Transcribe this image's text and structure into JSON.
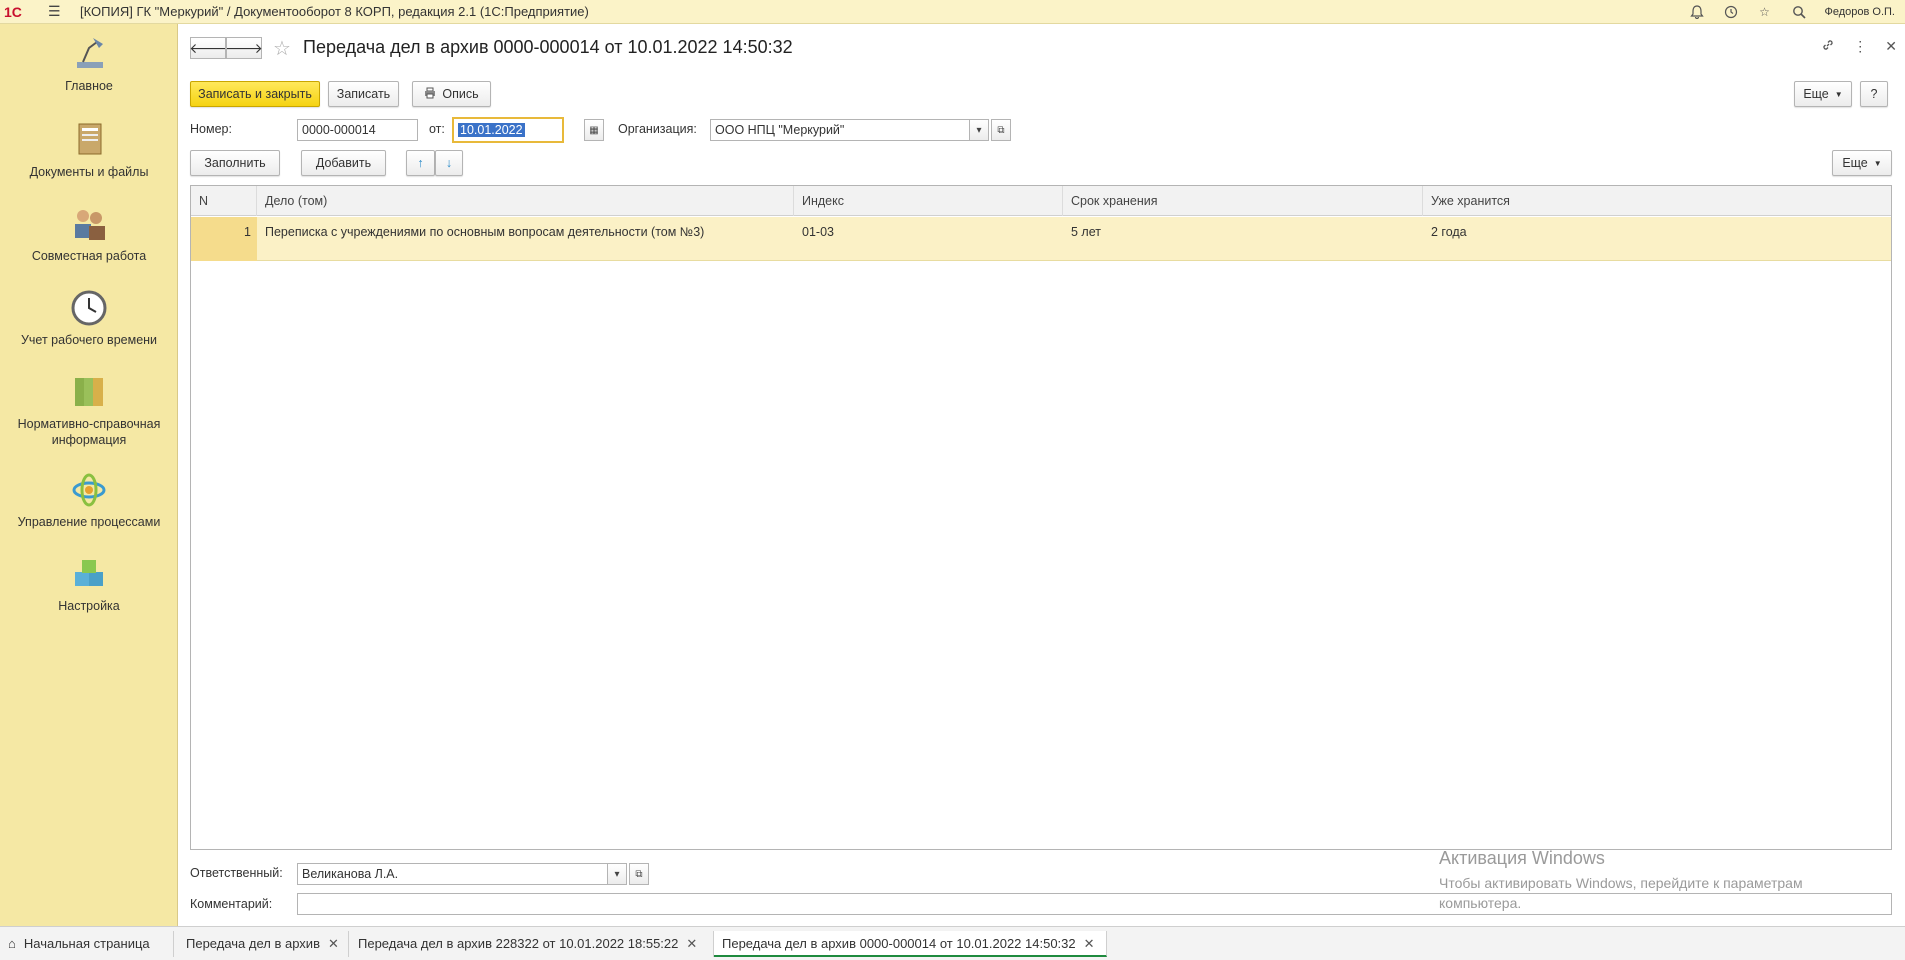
{
  "titlebar": {
    "logo": "1С",
    "title": "[КОПИЯ] ГК \"Меркурий\" / Документооборот 8 КОРП, редакция 2.1  (1С:Предприятие)",
    "user": "Федоров О.П."
  },
  "sidebar": {
    "items": [
      {
        "label": "Главное"
      },
      {
        "label": "Документы и файлы"
      },
      {
        "label": "Совместная работа"
      },
      {
        "label": "Учет рабочего времени"
      },
      {
        "label": "Нормативно-справочная информация"
      },
      {
        "label": "Управление процессами"
      },
      {
        "label": "Настройка"
      }
    ]
  },
  "header": {
    "title": "Передача дел в архив 0000-000014 от 10.01.2022 14:50:32"
  },
  "toolbar": {
    "save_close": "Записать и закрыть",
    "save": "Записать",
    "inventory": "Опись",
    "more": "Еще",
    "help": "?"
  },
  "form": {
    "number_label": "Номер:",
    "number_value": "0000-000014",
    "date_label": "от:",
    "date_value": "10.01.2022",
    "org_label": "Организация:",
    "org_value": "ООО НПЦ \"Меркурий\""
  },
  "table_toolbar": {
    "fill": "Заполнить",
    "add": "Добавить",
    "more": "Еще"
  },
  "table": {
    "columns": [
      "N",
      "Дело (том)",
      "Индекс",
      "Срок хранения",
      "Уже хранится"
    ],
    "rows": [
      {
        "n": "1",
        "case": "Переписка с учреждениями по основным вопросам деятельности (том №3)",
        "index": "01-03",
        "period": "5 лет",
        "stored": "2 года"
      }
    ]
  },
  "footer": {
    "responsible_label": "Ответственный:",
    "responsible_value": "Великанова Л.А.",
    "comment_label": "Комментарий:",
    "comment_value": ""
  },
  "watermark": {
    "line1": "Активация Windows",
    "line2": "Чтобы активировать Windows, перейдите к параметрам",
    "line3": "компьютера."
  },
  "taskbar": {
    "tabs": [
      {
        "label": "Начальная страница"
      },
      {
        "label": "Передача дел в архив"
      },
      {
        "label": "Передача дел в архив 228322 от 10.01.2022 18:55:22"
      },
      {
        "label": "Передача дел в архив 0000-000014 от 10.01.2022 14:50:32"
      }
    ]
  }
}
